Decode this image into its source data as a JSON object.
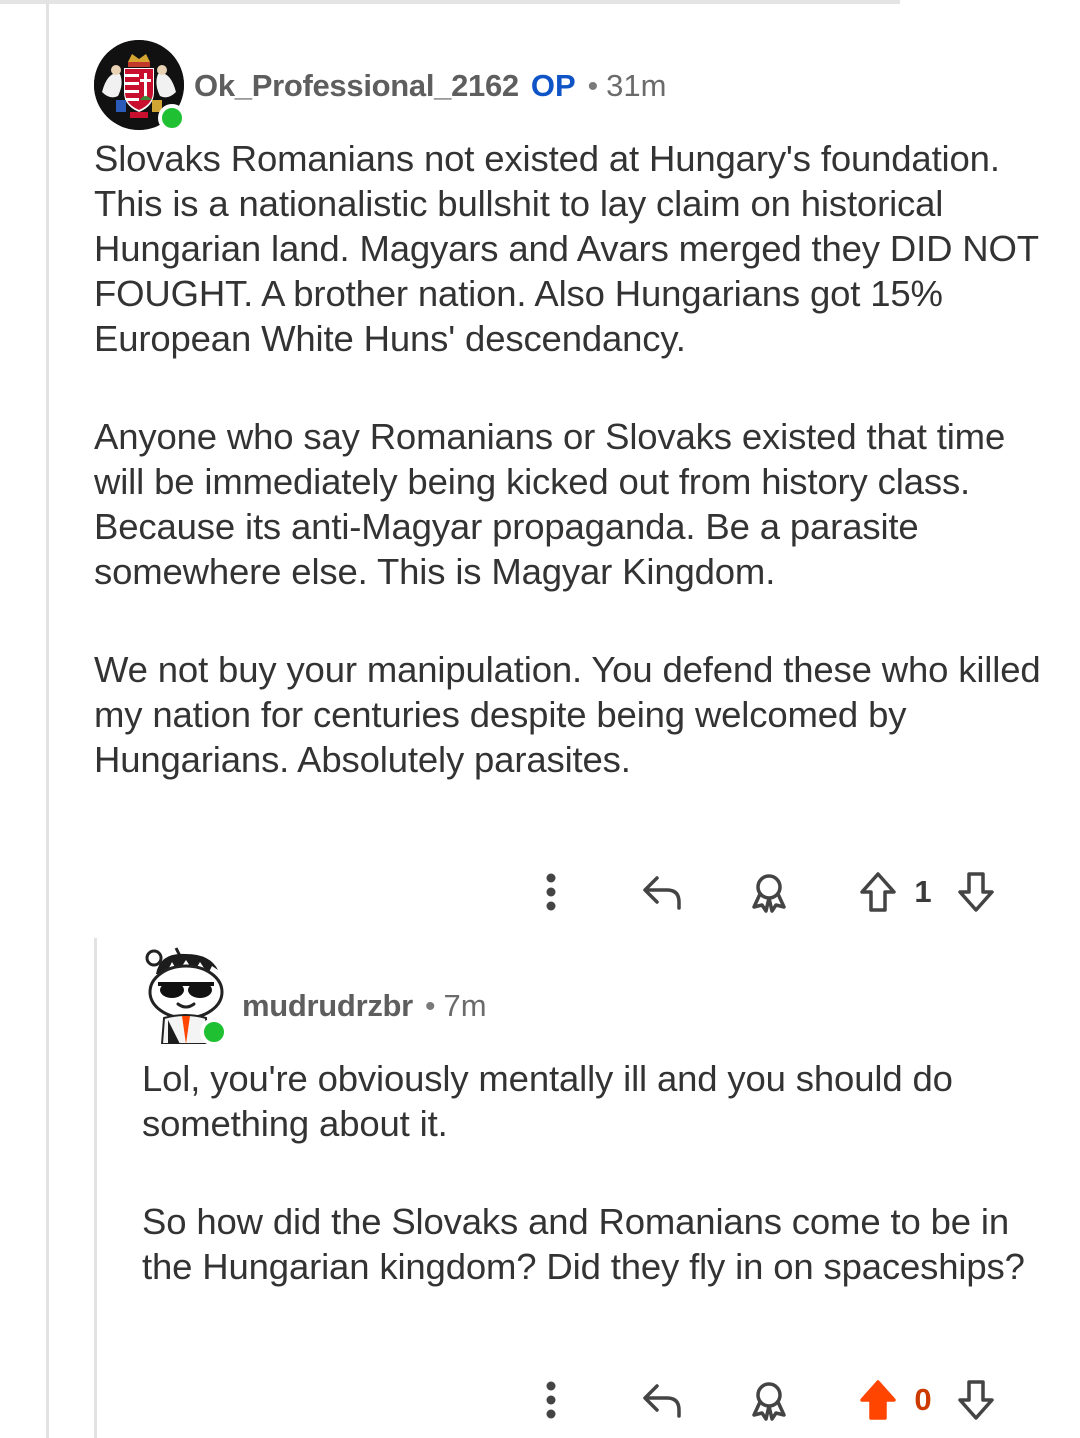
{
  "colors": {
    "op_badge": "#0e54c7",
    "online": "#1fc132",
    "upvoted": "#ff4500",
    "text": "#333333",
    "meta": "#5e5e5e"
  },
  "comments": [
    {
      "username": "Ok_Professional_2162",
      "op_label": "OP",
      "separator": "•",
      "time": "31m",
      "avatar": "hungarian-coat-of-arms-avatar",
      "online": true,
      "paragraphs": [
        "Slovaks Romanians not existed at Hungary's foundation. This is a nationalistic bullshit to lay claim on historical Hungarian land. Magyars and Avars merged they DID NOT FOUGHT. A brother nation. Also Hungarians got 15% European White Huns' descendancy.",
        "Anyone who say Romanians or Slovaks existed that time will be immediately being kicked out from history class. Because its anti-Magyar propaganda. Be a parasite somewhere else. This is Magyar Kingdom.",
        "We not buy your manipulation. You defend these who killed my nation for centuries despite being welcomed by Hungarians. Absolutely parasites."
      ],
      "actions": {
        "more_icon": "more-vertical-icon",
        "reply_icon": "reply-icon",
        "award_icon": "award-icon",
        "upvote_icon": "upvote-icon",
        "vote_count": "1",
        "downvote_icon": "downvote-icon",
        "upvoted": false
      }
    },
    {
      "username": "mudrudrzbr",
      "separator": "•",
      "time": "7m",
      "avatar": "snoo-sunglasses-avatar",
      "online": true,
      "paragraphs": [
        "Lol, you're obviously mentally ill and you should do something about it.",
        "So how did the Slovaks and Romanians come to be in the Hungarian kingdom? Did they fly in on spaceships?"
      ],
      "actions": {
        "more_icon": "more-vertical-icon",
        "reply_icon": "reply-icon",
        "award_icon": "award-icon",
        "upvote_icon": "upvote-icon",
        "vote_count": "0",
        "downvote_icon": "downvote-icon",
        "upvoted": true
      }
    }
  ]
}
